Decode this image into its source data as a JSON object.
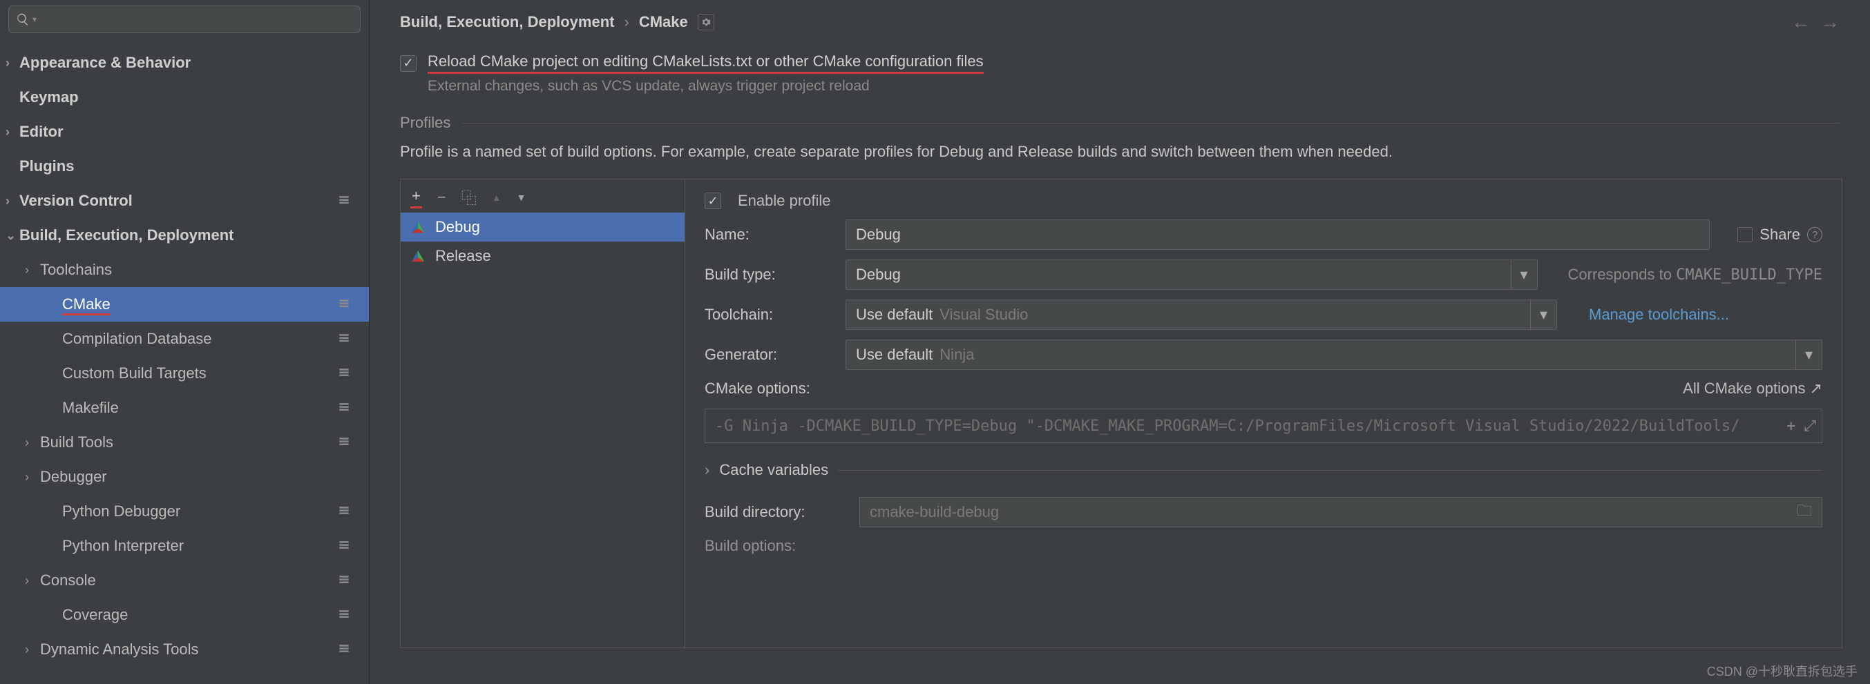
{
  "search": {
    "placeholder": ""
  },
  "sidebar": {
    "items": [
      {
        "label": "Appearance & Behavior",
        "bold": true,
        "expandable": true
      },
      {
        "label": "Keymap",
        "bold": true
      },
      {
        "label": "Editor",
        "bold": true,
        "expandable": true
      },
      {
        "label": "Plugins",
        "bold": true
      },
      {
        "label": "Version Control",
        "bold": true,
        "expandable": true,
        "gear": true
      },
      {
        "label": "Build, Execution, Deployment",
        "bold": true,
        "expandable": true,
        "expanded": true
      },
      {
        "label": "Toolchains",
        "level": 1,
        "expandable": true
      },
      {
        "label": "CMake",
        "level": 2,
        "selected": true,
        "gear": true,
        "redline": true
      },
      {
        "label": "Compilation Database",
        "level": 2,
        "gear": true
      },
      {
        "label": "Custom Build Targets",
        "level": 2,
        "gear": true
      },
      {
        "label": "Makefile",
        "level": 2,
        "gear": true
      },
      {
        "label": "Build Tools",
        "level": 1,
        "expandable": true,
        "gear": true
      },
      {
        "label": "Debugger",
        "level": 1,
        "expandable": true
      },
      {
        "label": "Python Debugger",
        "level": 2,
        "gear": true
      },
      {
        "label": "Python Interpreter",
        "level": 2,
        "gear": true
      },
      {
        "label": "Console",
        "level": 1,
        "expandable": true,
        "gear": true
      },
      {
        "label": "Coverage",
        "level": 2,
        "gear": true
      },
      {
        "label": "Dynamic Analysis Tools",
        "level": 1,
        "expandable": true,
        "gear": true
      }
    ]
  },
  "breadcrumb": {
    "root": "Build, Execution, Deployment",
    "sep": "›",
    "leaf": "CMake"
  },
  "reload": {
    "label": "Reload CMake project on editing CMakeLists.txt or other CMake configuration files",
    "hint": "External changes, such as VCS update, always trigger project reload",
    "checked": true
  },
  "profiles_section": {
    "title": "Profiles",
    "description": "Profile is a named set of build options. For example, create separate profiles for Debug and Release builds and switch between them when needed."
  },
  "profile_toolbar": {
    "add": "+",
    "remove": "−",
    "copy": "⿻",
    "up": "▲",
    "down": "▼"
  },
  "profile_list": [
    {
      "name": "Debug",
      "selected": true
    },
    {
      "name": "Release"
    }
  ],
  "detail": {
    "enable_profile_label": "Enable profile",
    "enable_profile_checked": true,
    "name_label": "Name:",
    "name_value": "Debug",
    "share_label": "Share",
    "build_type_label": "Build type:",
    "build_type_value": "Debug",
    "build_type_hint_prefix": "Corresponds to ",
    "build_type_hint_mono": "CMAKE_BUILD_TYPE",
    "toolchain_label": "Toolchain:",
    "toolchain_value": "Use default",
    "toolchain_placeholder": "Visual Studio",
    "toolchain_link": "Manage toolchains...",
    "generator_label": "Generator:",
    "generator_value": "Use default",
    "generator_placeholder": "Ninja",
    "cmake_options_label": "CMake options:",
    "cmake_options_link": "All CMake options ↗",
    "cmake_options_value": "-G Ninja -DCMAKE_BUILD_TYPE=Debug \"-DCMAKE_MAKE_PROGRAM=C:/ProgramFiles/Microsoft Visual Studio/2022/BuildTools/",
    "cache_vars_label": "Cache variables",
    "build_dir_label": "Build directory:",
    "build_dir_value": "cmake-build-debug",
    "build_options_label": "Build options:"
  },
  "watermark": "CSDN @十秒耿直拆包选手"
}
